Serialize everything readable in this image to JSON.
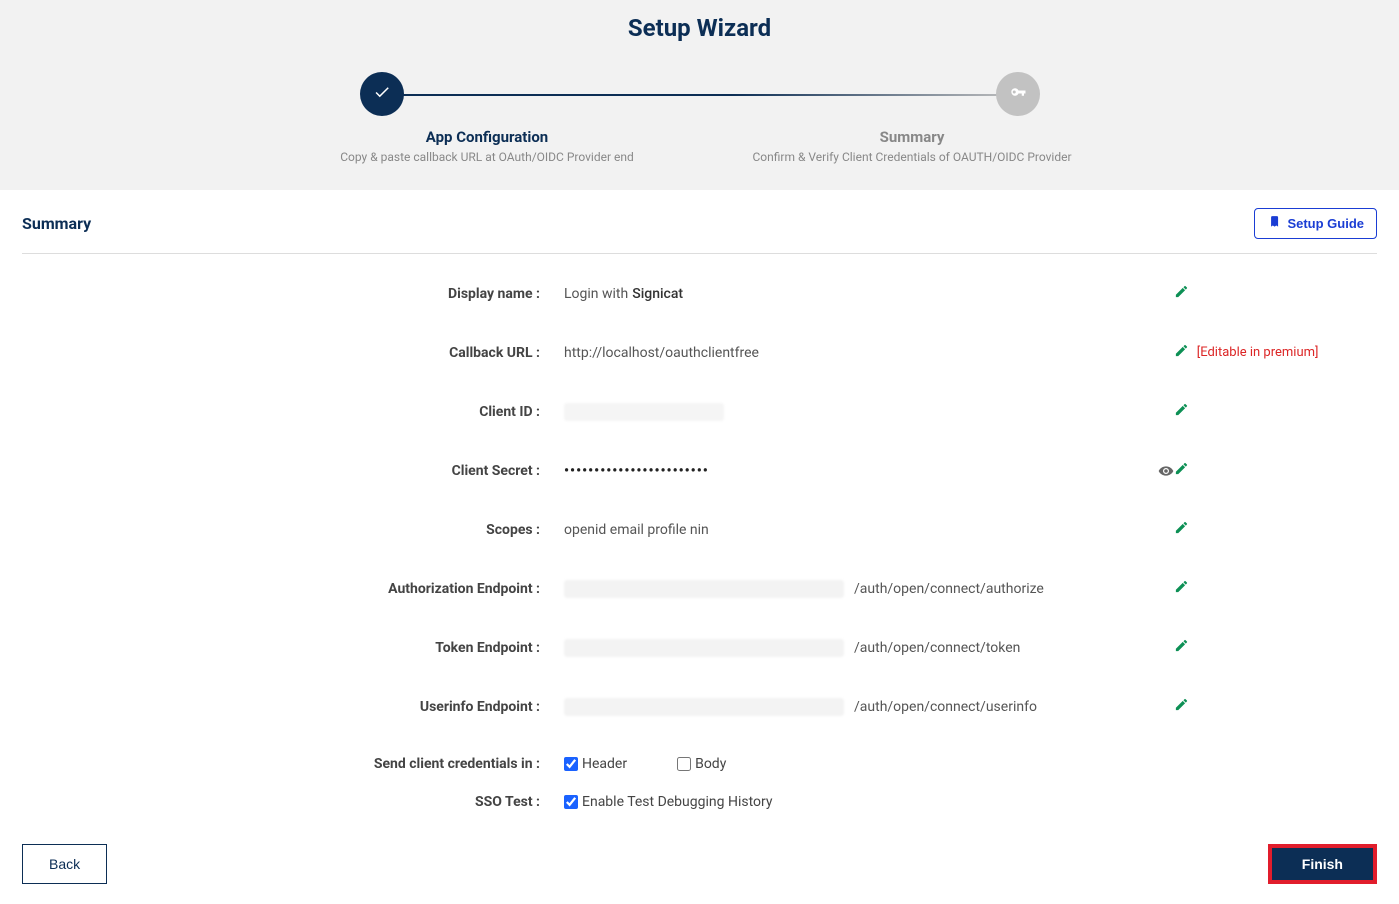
{
  "title": "Setup Wizard",
  "steps": {
    "app_config": {
      "title": "App Configuration",
      "desc": "Copy & paste callback URL at OAuth/OIDC Provider end"
    },
    "summary": {
      "title": "Summary",
      "desc": "Confirm & Verify Client Credentials of OAUTH/OIDC Provider"
    }
  },
  "panel": {
    "heading": "Summary",
    "setup_guide": "Setup Guide"
  },
  "fields": {
    "display_name": {
      "label": "Display name :",
      "value_prefix": "Login with ",
      "value_suffix": "Signicat"
    },
    "callback_url": {
      "label": "Callback URL :",
      "value": "http://localhost/oauthclientfree",
      "premium_note": "[Editable in premium]"
    },
    "client_id": {
      "label": "Client ID :"
    },
    "client_secret": {
      "label": "Client Secret :",
      "value": "••••••••••••••••••••••••"
    },
    "scopes": {
      "label": "Scopes :",
      "value": "openid email profile nin"
    },
    "auth_ep": {
      "label": "Authorization Endpoint :",
      "suffix": "/auth/open/connect/authorize"
    },
    "token_ep": {
      "label": "Token Endpoint :",
      "suffix": "/auth/open/connect/token"
    },
    "userinfo_ep": {
      "label": "Userinfo Endpoint :",
      "suffix": "/auth/open/connect/userinfo"
    },
    "send_creds": {
      "label": "Send client credentials in :",
      "opt_header": "Header",
      "opt_body": "Body"
    },
    "sso_test": {
      "label": "SSO Test :",
      "opt_enable": "Enable Test Debugging History"
    }
  },
  "buttons": {
    "back": "Back",
    "finish": "Finish"
  }
}
